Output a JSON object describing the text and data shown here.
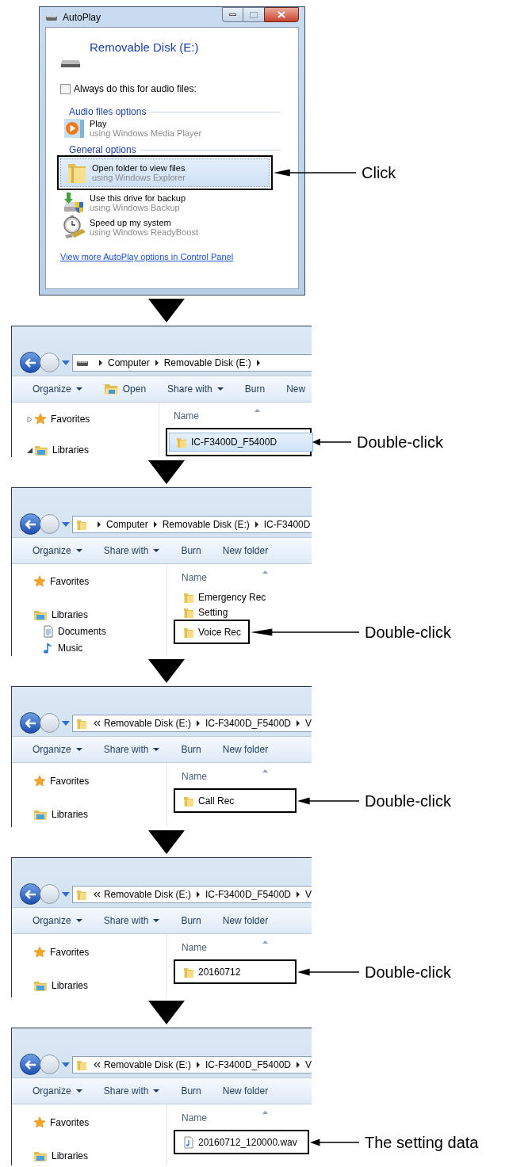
{
  "autoplay": {
    "title": "AutoPlay",
    "device": "Removable Disk (E:)",
    "always": {
      "label": "Always do this for audio files:",
      "checked": false
    },
    "sections": [
      {
        "heading": "Audio files options",
        "options": [
          {
            "kind": "media_player",
            "title": "Play",
            "subtitle": "using Windows Media Player",
            "selected": false
          }
        ]
      },
      {
        "heading": "General options",
        "options": [
          {
            "kind": "folder",
            "title": "Open folder to view files",
            "subtitle": "using Windows Explorer",
            "selected": true
          },
          {
            "kind": "backup",
            "title": "Use this drive for backup",
            "subtitle": "using Windows Backup",
            "selected": false
          },
          {
            "kind": "readyboost",
            "title": "Speed up my system",
            "subtitle": "using Windows ReadyBoost",
            "selected": false
          }
        ]
      }
    ],
    "link": "View more AutoPlay options in Control Panel",
    "callout": "Click"
  },
  "steps": [
    {
      "address": {
        "collapsed": false,
        "kind": "drive",
        "parts": [
          "Computer",
          "Removable Disk (E:)"
        ],
        "trailing_separator": true
      },
      "toolbar": [
        {
          "label": "Organize",
          "kind": "dropdown"
        },
        {
          "label": "Open",
          "kind": "icon"
        },
        {
          "label": "Share with",
          "kind": "dropdown"
        },
        {
          "label": "Burn",
          "kind": "plain"
        },
        {
          "label": "New",
          "kind": "plain"
        }
      ],
      "nav": [
        {
          "label": "Favorites",
          "kind": "favorites",
          "expanded": false
        },
        {
          "label": "Libraries",
          "kind": "libraries",
          "expanded": true
        }
      ],
      "column": "Name",
      "files": [
        {
          "name": "IC-F3400D_F5400D",
          "kind": "folder",
          "selected": true,
          "boxed": true
        }
      ],
      "callout": "Double-click"
    },
    {
      "address": {
        "collapsed": false,
        "kind": "folder",
        "parts": [
          "Computer",
          "Removable Disk (E:)",
          "IC-F3400D"
        ],
        "trailing_separator": false
      },
      "toolbar": [
        {
          "label": "Organize",
          "kind": "dropdown"
        },
        {
          "label": "Share with",
          "kind": "dropdown"
        },
        {
          "label": "Burn",
          "kind": "plain"
        },
        {
          "label": "New folder",
          "kind": "plain"
        }
      ],
      "nav": [
        {
          "label": "Favorites",
          "kind": "favorites"
        },
        {
          "label": "Libraries",
          "kind": "libraries",
          "children": [
            {
              "label": "Documents",
              "kind": "documents"
            },
            {
              "label": "Music",
              "kind": "music"
            }
          ]
        }
      ],
      "column": "Name",
      "files": [
        {
          "name": "Emergency Rec",
          "kind": "folder",
          "selected": false,
          "boxed": false
        },
        {
          "name": "Setting",
          "kind": "folder",
          "selected": false,
          "boxed": false
        },
        {
          "name": "Voice Rec",
          "kind": "folder",
          "selected": false,
          "boxed": true
        }
      ],
      "callout": "Double-click"
    },
    {
      "address": {
        "collapsed": true,
        "kind": "folder",
        "parts": [
          "Removable Disk (E:)",
          "IC-F3400D_F5400D",
          "V"
        ],
        "trailing_separator": false
      },
      "toolbar": [
        {
          "label": "Organize",
          "kind": "dropdown"
        },
        {
          "label": "Share with",
          "kind": "dropdown"
        },
        {
          "label": "Burn",
          "kind": "plain"
        },
        {
          "label": "New folder",
          "kind": "plain"
        }
      ],
      "nav": [
        {
          "label": "Favorites",
          "kind": "favorites"
        },
        {
          "label": "Libraries",
          "kind": "libraries"
        }
      ],
      "column": "Name",
      "files": [
        {
          "name": "Call Rec",
          "kind": "folder",
          "selected": false,
          "boxed": true
        }
      ],
      "callout": "Double-click"
    },
    {
      "address": {
        "collapsed": true,
        "kind": "folder",
        "parts": [
          "Removable Disk (E:)",
          "IC-F3400D_F5400D",
          "V"
        ],
        "trailing_separator": false
      },
      "toolbar": [
        {
          "label": "Organize",
          "kind": "dropdown"
        },
        {
          "label": "Share with",
          "kind": "dropdown"
        },
        {
          "label": "Burn",
          "kind": "plain"
        },
        {
          "label": "New folder",
          "kind": "plain"
        }
      ],
      "nav": [
        {
          "label": "Favorites",
          "kind": "favorites"
        },
        {
          "label": "Libraries",
          "kind": "libraries"
        }
      ],
      "column": "Name",
      "files": [
        {
          "name": "20160712",
          "kind": "folder",
          "selected": false,
          "boxed": true
        }
      ],
      "callout": "Double-click"
    },
    {
      "address": {
        "collapsed": true,
        "kind": "folder",
        "parts": [
          "Removable Disk (E:)",
          "IC-F3400D_F5400D",
          "V"
        ],
        "trailing_separator": false
      },
      "toolbar": [
        {
          "label": "Organize",
          "kind": "dropdown"
        },
        {
          "label": "Share with",
          "kind": "dropdown"
        },
        {
          "label": "Burn",
          "kind": "plain"
        },
        {
          "label": "New folder",
          "kind": "plain"
        }
      ],
      "nav": [
        {
          "label": "Favorites",
          "kind": "favorites"
        },
        {
          "label": "Libraries",
          "kind": "libraries"
        }
      ],
      "column": "Name",
      "files": [
        {
          "name": "20160712_120000.wav",
          "kind": "audio",
          "selected": false,
          "boxed": true
        }
      ],
      "callout": "The setting data"
    }
  ]
}
